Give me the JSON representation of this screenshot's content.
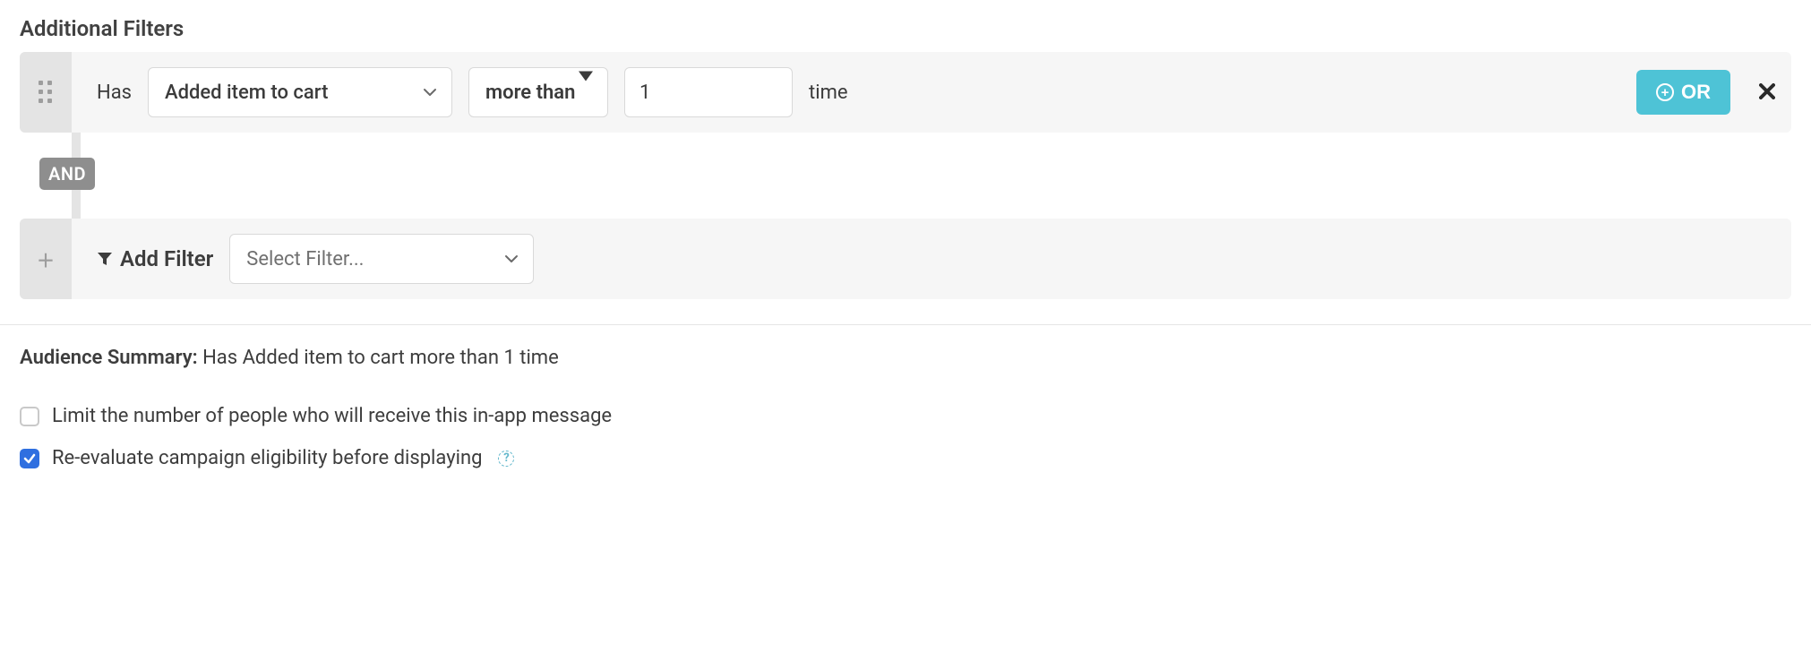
{
  "section_title": "Additional Filters",
  "filter": {
    "prefix": "Has",
    "event": "Added item to cart",
    "comparator": "more than",
    "count_value": "1",
    "suffix": "time",
    "or_label": "OR"
  },
  "connector_label": "AND",
  "add_filter": {
    "label": "Add Filter",
    "placeholder": "Select Filter..."
  },
  "summary": {
    "label": "Audience Summary:",
    "text": "Has Added item to cart more than 1 time"
  },
  "checkboxes": {
    "limit": {
      "label": "Limit the number of people who will receive this in-app message",
      "checked": false
    },
    "reevaluate": {
      "label": "Re-evaluate campaign eligibility before displaying",
      "checked": true
    }
  },
  "help_glyph": "?"
}
